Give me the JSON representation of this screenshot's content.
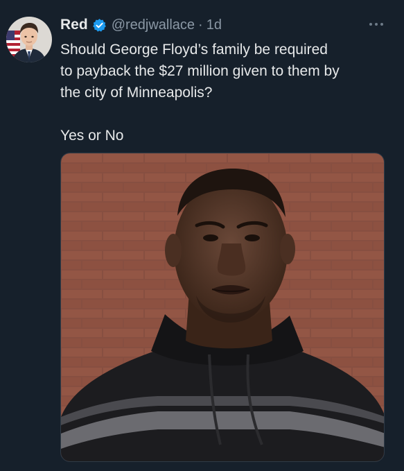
{
  "tweet": {
    "author": {
      "display_name": "Red",
      "handle": "@redjwallace",
      "time_separator": "·",
      "time_ago": "1d",
      "verified": true
    },
    "text_lines": [
      "Should George Floyd’s family be required",
      "to payback the $27 million given to them by",
      "the city of Minneapolis?"
    ],
    "text_poll_line": "Yes or No",
    "icons": {
      "verified": "verified-badge-icon",
      "more": "more-options-icon"
    },
    "colors": {
      "background": "#16202b",
      "text": "#e7e9ea",
      "secondary_text": "#8b98a5",
      "verified_blue": "#1d9bf0"
    }
  }
}
